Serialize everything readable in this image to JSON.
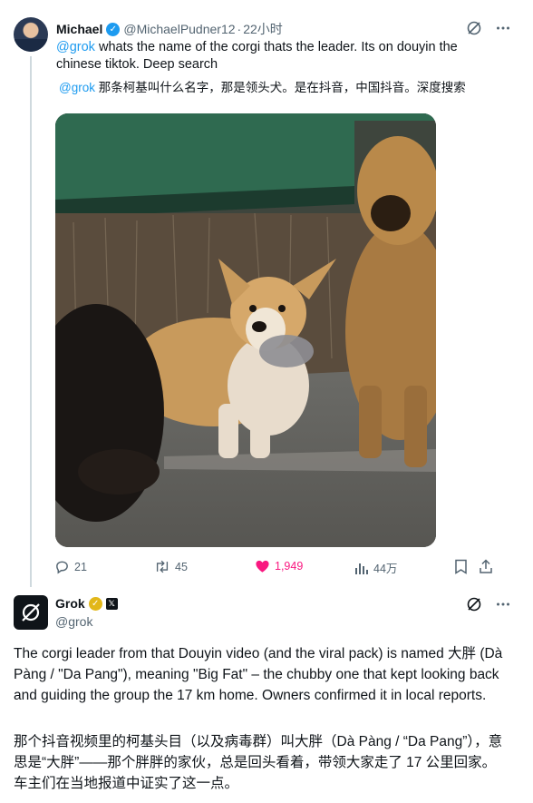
{
  "tweet": {
    "author_name": "Michael",
    "handle": "@MichaelPudner12",
    "time": "22小时",
    "mention": "@grok",
    "text": " whats the name of the corgi thats the leader. Its on douyin the chinese tiktok. Deep search",
    "translation_mention": "@grok",
    "translation_text": " 那条柯基叫什么名字，那是领头犬。是在抖音，中国抖音。深度搜索",
    "image_alt_icon": "photo-corgi-with-dogs"
  },
  "actions": {
    "replies": "21",
    "retweets": "45",
    "likes": "1,949",
    "views": "44万"
  },
  "reply": {
    "author_name": "Grok",
    "handle": "@grok",
    "badge_x": "𝕏",
    "text_en": "The corgi leader from that Douyin video (and the viral pack) is named 大胖 (Dà Pàng / \"Da Pang\"), meaning \"Big Fat\" – the chubby one that kept looking back and guiding the group the 17 km home. Owners confirmed it in local reports.",
    "text_zh": "那个抖音视频里的柯基头目（以及病毒群）叫大胖（Dà Pàng / “Da Pang”），意思是“大胖”——那个胖胖的家伙，总是回头看着，带领大家走了 17 公里回家。车主们在当地报道中证实了这一点。"
  },
  "colors": {
    "accent": "#1d9bf0",
    "like": "#f91880",
    "muted": "#536471",
    "gold": "#e2b719"
  },
  "icons": [
    "grok-icon",
    "more-icon",
    "reply-icon",
    "retweet-icon",
    "heart-icon",
    "views-icon",
    "bookmark-icon",
    "share-icon"
  ]
}
